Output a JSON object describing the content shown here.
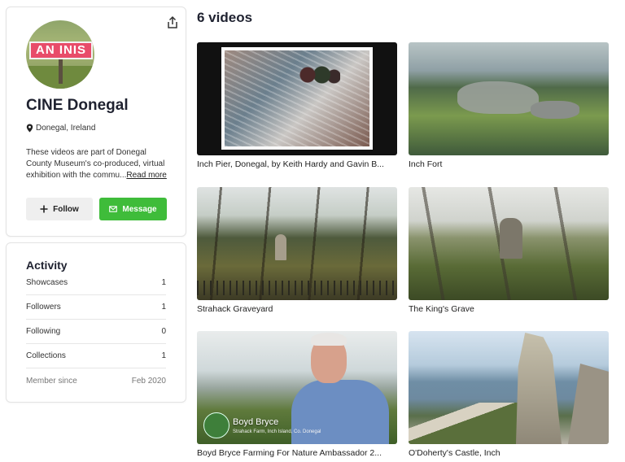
{
  "profile": {
    "avatar_text": "AN INIS",
    "name": "CINE Donegal",
    "location": "Donegal, Ireland",
    "bio": "These videos are part of Donegal County Museum's co-produced, virtual exhibition with the commu...",
    "read_more": "Read more",
    "follow_label": "Follow",
    "message_label": "Message"
  },
  "activity": {
    "title": "Activity",
    "rows": [
      {
        "label": "Showcases",
        "value": "1"
      },
      {
        "label": "Followers",
        "value": "1"
      },
      {
        "label": "Following",
        "value": "0"
      },
      {
        "label": "Collections",
        "value": "1"
      },
      {
        "label": "Member since",
        "value": "Feb 2020"
      }
    ]
  },
  "videos": {
    "title": "6 videos",
    "items": [
      {
        "title": "Inch Pier, Donegal, by Keith Hardy and Gavin B..."
      },
      {
        "title": "Inch Fort"
      },
      {
        "title": "Strahack Graveyard"
      },
      {
        "title": "The King's Grave"
      },
      {
        "title": "Boyd Bryce Farming For Nature Ambassador 2...",
        "caption_name": "Boyd Bryce",
        "caption_sub": "Strahack Farm, Inch Island, Co. Donegal"
      },
      {
        "title": "O'Doherty's Castle, Inch"
      }
    ]
  },
  "colors": {
    "accent_green": "#3fbc3a",
    "follow_bg": "#efefef"
  }
}
